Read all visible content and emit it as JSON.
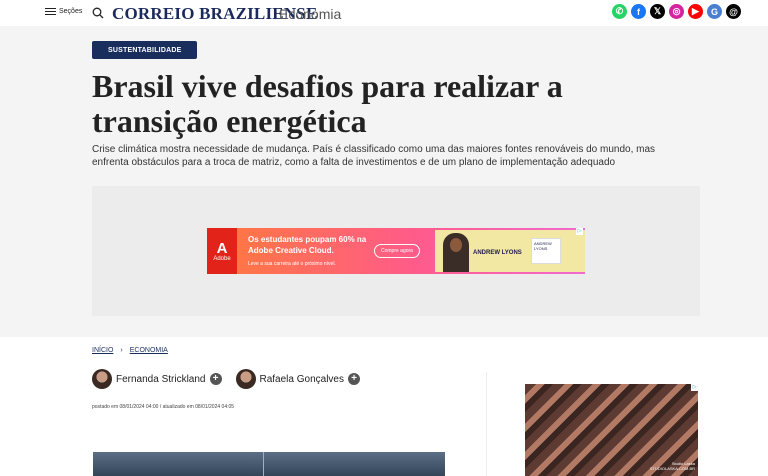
{
  "header": {
    "sections_label": "Seções",
    "logo_main": "CORREIO BRAZILIENSE",
    "section_name": "Economia",
    "social": [
      {
        "icon": "whatsapp-icon",
        "glyph": "✆",
        "color": "#25d366"
      },
      {
        "icon": "facebook-icon",
        "glyph": "f",
        "color": "#1877f2"
      },
      {
        "icon": "x-icon",
        "glyph": "𝕏",
        "color": "#000000"
      },
      {
        "icon": "instagram-icon",
        "glyph": "◎",
        "color": "#d6249f"
      },
      {
        "icon": "youtube-icon",
        "glyph": "▶",
        "color": "#ff0000"
      },
      {
        "icon": "news-icon",
        "glyph": "G",
        "color": "#4a7fd0"
      },
      {
        "icon": "threads-icon",
        "glyph": "@",
        "color": "#000000"
      }
    ]
  },
  "article": {
    "tag": "SUSTENTABILIDADE",
    "headline": "Brasil vive desafios para realizar a transição energética",
    "subtitle": "Crise climática mostra necessidade de mudança. País é classificado como uma das maiores fontes renováveis do mundo, mas enfrenta obstáculos para a troca de matriz, como a falta de investimentos e de um plano de implementação adequado",
    "breadcrumb": [
      "INÍCIO",
      "ECONOMIA"
    ],
    "authors": [
      "Fernanda Strickland",
      "Rafaela Gonçalves"
    ],
    "dates": "postado em 08/01/2024 04:00 / atualizado em 08/01/2024 04:05"
  },
  "ad": {
    "brand_letter": "A",
    "brand": "Adobe",
    "headline": "Os estudantes poupam 60% na Adobe Creative Cloud.",
    "small": "Leve a sua carreira até o próximo nível.",
    "button": "Compre agora",
    "name": "ANDREW LYONS",
    "mini": "ANDREW LYONS"
  },
  "side_ad": {
    "label": "Studio Laska",
    "label2": "STUDIOLASKA.COM.BR"
  }
}
